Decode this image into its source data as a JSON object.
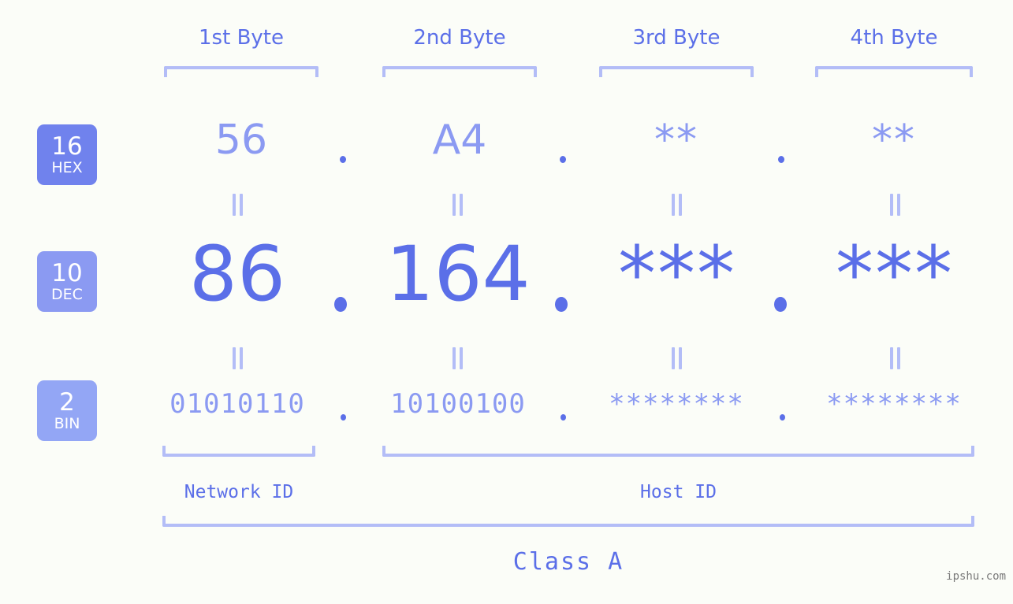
{
  "page": {
    "background_color": "#fbfdf8",
    "accent_color": "#5b6fe8",
    "accent_light_color": "#8b9af2",
    "bracket_color": "#b3bdf7"
  },
  "headers": [
    {
      "label": "1st Byte"
    },
    {
      "label": "2nd Byte"
    },
    {
      "label": "3rd Byte"
    },
    {
      "label": "4th Byte"
    }
  ],
  "bases": [
    {
      "num": "16",
      "name": "HEX",
      "color": "#7082ed"
    },
    {
      "num": "10",
      "name": "DEC",
      "color": "#8b9af2"
    },
    {
      "num": "2",
      "name": "BIN",
      "color": "#93a6f5"
    }
  ],
  "rows": {
    "hex": {
      "base_num": "16",
      "base_name": "HEX",
      "values": [
        "56",
        "A4",
        "**",
        "**"
      ],
      "separators": [
        ".",
        ".",
        "."
      ]
    },
    "dec": {
      "base_num": "10",
      "base_name": "DEC",
      "values": [
        "86",
        "164",
        "***",
        "***"
      ],
      "separators": [
        ".",
        ".",
        "."
      ]
    },
    "bin": {
      "base_num": "2",
      "base_name": "BIN",
      "values": [
        "01010110",
        "10100100",
        "********",
        "********"
      ],
      "separators": [
        ".",
        ".",
        "."
      ]
    }
  },
  "equality_marks": {
    "symbol": "||",
    "count_upper": 4,
    "count_lower": 4
  },
  "segments": {
    "network_id_label": "Network ID",
    "host_id_label": "Host ID",
    "class_label": "Class A"
  },
  "watermark": {
    "text": "ipshu.com"
  }
}
